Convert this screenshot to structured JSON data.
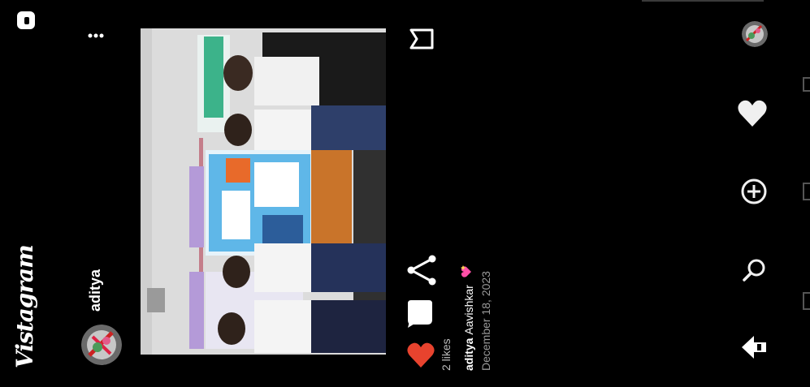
{
  "app": {
    "logo_text": "Vistagram"
  },
  "post": {
    "username": "aditya",
    "likes_text": "2 likes",
    "caption": {
      "username": "aditya",
      "text": "Aavishkar",
      "emoji": "sparkle-heart"
    },
    "date": "December 18, 2023"
  },
  "icons": {
    "messages": "chat-icon",
    "more": "more-icon",
    "save": "bookmark-icon",
    "share": "share-icon",
    "comment": "comment-icon",
    "like": "heart-icon"
  },
  "nav": {
    "items": [
      "profile",
      "activity",
      "create",
      "search",
      "home"
    ]
  },
  "colors": {
    "background": "#000000",
    "like": "#e8432e",
    "muted": "#9a9a9a"
  }
}
